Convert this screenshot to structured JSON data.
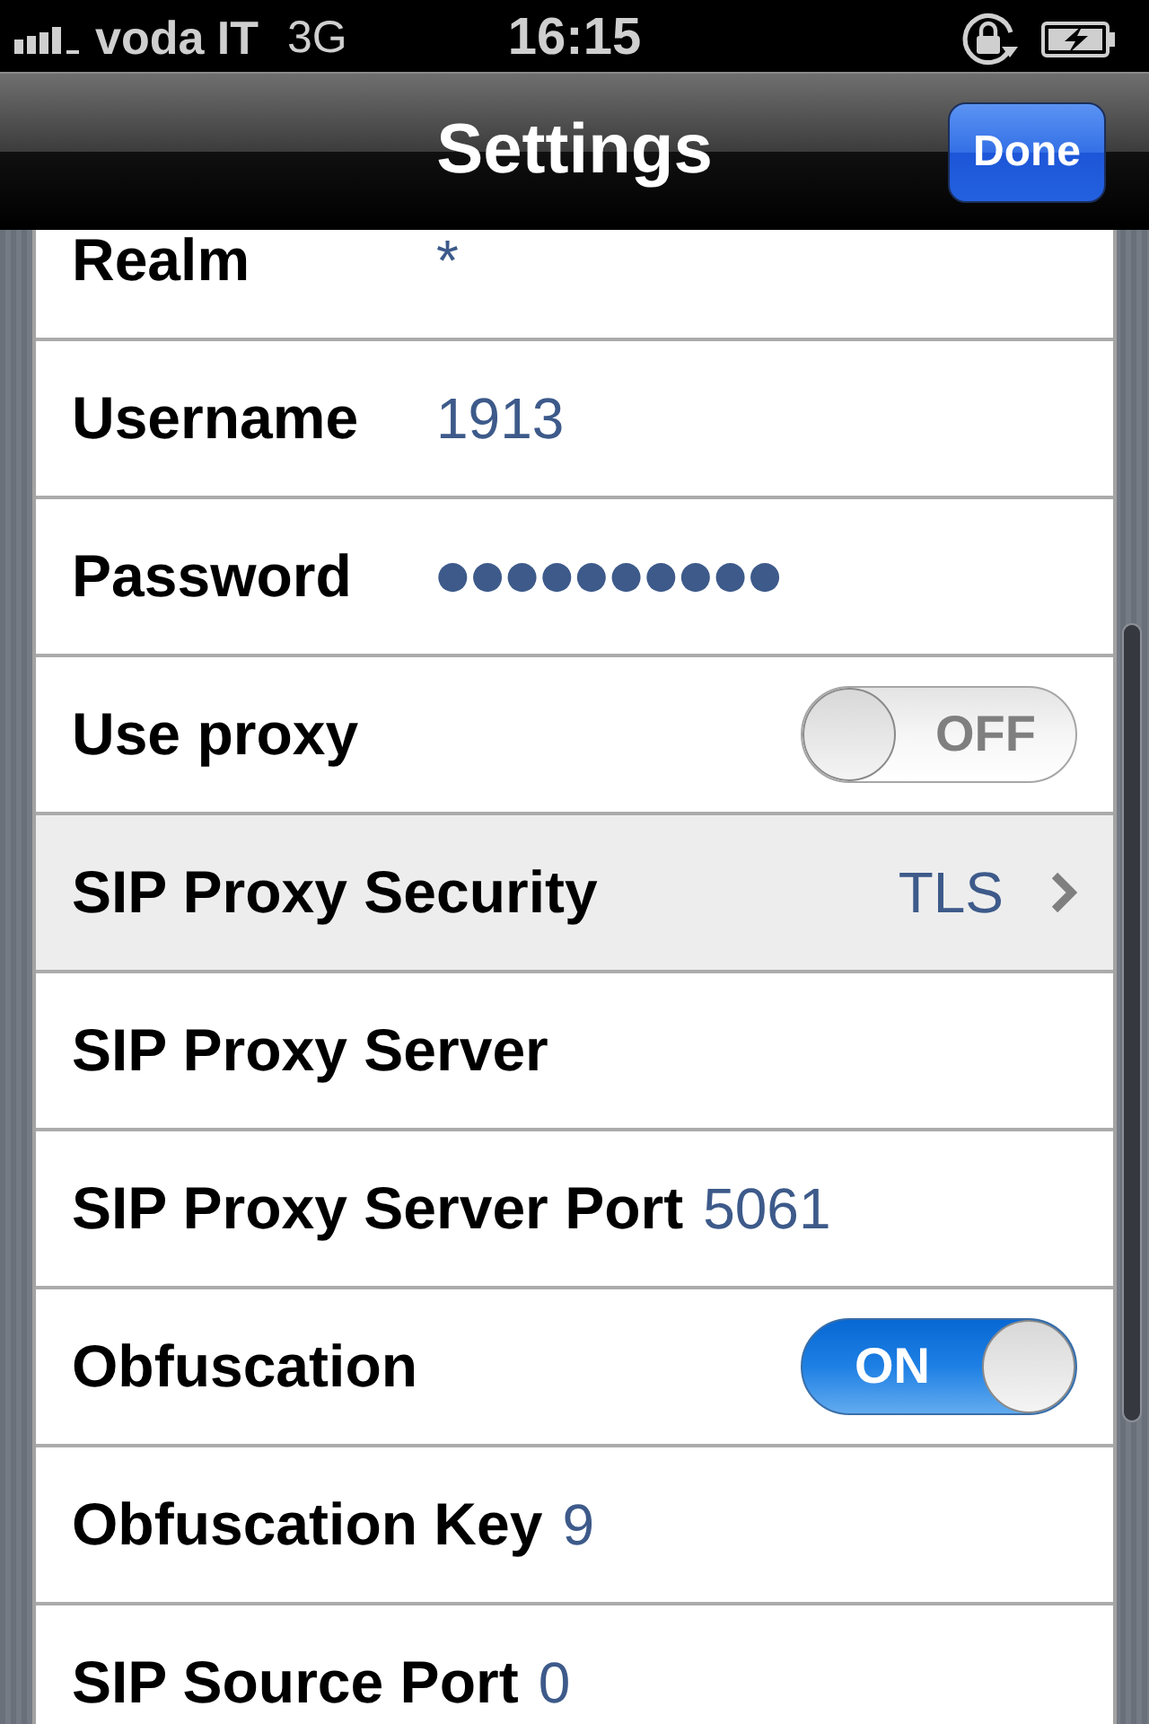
{
  "status_bar": {
    "carrier": "voda IT",
    "network": "3G",
    "time": "16:15"
  },
  "nav_bar": {
    "title": "Settings",
    "done_button": "Done"
  },
  "rows": [
    {
      "kind": "field",
      "label": "Realm",
      "value": "*",
      "selected": false
    },
    {
      "kind": "field",
      "label": "Username",
      "value": "1913",
      "selected": false
    },
    {
      "kind": "password",
      "label": "Password",
      "value": "●●●●●●●●●●",
      "selected": false
    },
    {
      "kind": "switch",
      "label": "Use proxy",
      "on": false,
      "switch_label": "OFF",
      "selected": false
    },
    {
      "kind": "disclosure",
      "label": "SIP Proxy Security",
      "value": "TLS",
      "selected": true
    },
    {
      "kind": "inline",
      "label": "SIP Proxy Server",
      "selected": false
    },
    {
      "kind": "inline",
      "label": "SIP Proxy Server Port",
      "value": "5061",
      "selected": false
    },
    {
      "kind": "switch",
      "label": "Obfuscation",
      "on": true,
      "switch_label": "ON",
      "selected": false
    },
    {
      "kind": "inline",
      "label": "Obfuscation Key",
      "value": "9",
      "selected": false
    },
    {
      "kind": "inline",
      "label": "SIP Source Port",
      "value": "0",
      "selected": false
    }
  ]
}
